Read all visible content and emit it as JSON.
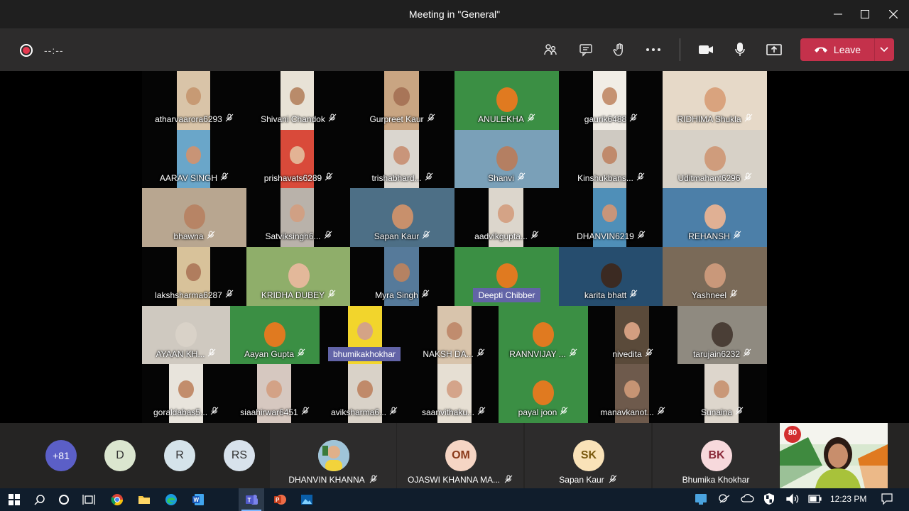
{
  "window": {
    "title": "Meeting in \"General\"",
    "controls": [
      "minimize-icon",
      "maximize-icon",
      "close-icon"
    ]
  },
  "toolbar": {
    "recording_timer": "--:--",
    "buttons": [
      "people-icon",
      "chat-icon",
      "raise-hand-icon",
      "more-icon",
      "camera-icon",
      "microphone-icon",
      "share-screen-icon"
    ],
    "leave_label": "Leave",
    "leave_color": "#c4314b"
  },
  "grid": {
    "tiles": [
      {
        "name": "atharvaarora6293"
      },
      {
        "name": "Shivani Chandok"
      },
      {
        "name": "Gurpreet Kaur"
      },
      {
        "name": "ANULEKHA"
      },
      {
        "name": "gaurik6488"
      },
      {
        "name": "RIDHIMA Shukla"
      },
      {
        "name": "AARAV SINGH"
      },
      {
        "name": "prishavats6289"
      },
      {
        "name": "trishabhard..."
      },
      {
        "name": "Shanvi"
      },
      {
        "name": "Kinshukbans..."
      },
      {
        "name": "Uditmahant6296"
      },
      {
        "name": "bhawna"
      },
      {
        "name": "Satviksingh6..."
      },
      {
        "name": "Sapan Kaur"
      },
      {
        "name": "aadvikgupta..."
      },
      {
        "name": "DHANVIN6219"
      },
      {
        "name": "REHANSH"
      },
      {
        "name": "lakshsharma6287"
      },
      {
        "name": "KRIDHA DUBEY"
      },
      {
        "name": "Myra Singh"
      },
      {
        "name": "Deepti Chibber",
        "speaking": true
      },
      {
        "name": "karita bhatt"
      },
      {
        "name": "Yashneel"
      },
      {
        "name": "AYAAN KH..."
      },
      {
        "name": "Aayan Gupta"
      },
      {
        "name": "bhumikakhokhar",
        "speaking": true
      },
      {
        "name": "NAKSH DA..."
      },
      {
        "name": "RANNVIJAY ..."
      },
      {
        "name": "nivedita"
      },
      {
        "name": "tarujain6232"
      },
      {
        "name": "goraldabas5..."
      },
      {
        "name": "siaahirwar6451"
      },
      {
        "name": "aviksharma6..."
      },
      {
        "name": "saanvithaku..."
      },
      {
        "name": "payal joon"
      },
      {
        "name": "manavkanot..."
      },
      {
        "name": "Sunaina"
      }
    ]
  },
  "roster": {
    "more_count": "+81",
    "avatars": [
      "D",
      "R",
      "RS"
    ],
    "cards": [
      {
        "name": "DHANVIN KHANNA",
        "initials": "",
        "avatar_color": "#cfe3f0"
      },
      {
        "name": "OJASWI KHANNA MA...",
        "initials": "OM",
        "avatar_color": "#f5d5c4"
      },
      {
        "name": "Sapan Kaur",
        "initials": "SK",
        "avatar_color": "#f9e2b8"
      },
      {
        "name": "Bhumika Khokhar",
        "initials": "BK",
        "avatar_color": "#f7d9dc"
      }
    ],
    "self_view_badge": "80"
  },
  "taskbar": {
    "icons": [
      "windows-icon",
      "search-icon",
      "cortana-icon",
      "task-view-icon",
      "chrome-icon",
      "file-explorer-icon",
      "edge-icon",
      "word-icon",
      "teams-icon",
      "powerpoint-icon",
      "photos-icon"
    ],
    "clock": "12:23 PM"
  }
}
